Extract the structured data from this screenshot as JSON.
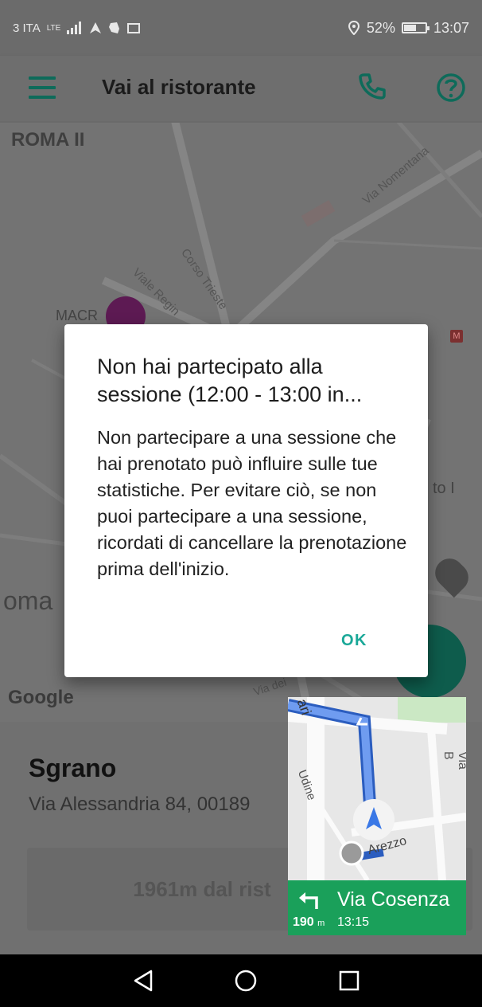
{
  "status_bar": {
    "carrier": "3 ITA",
    "network": "LTE",
    "battery_percent": "52%",
    "battery_level": 0.52,
    "time": "13:07"
  },
  "app_bar": {
    "title": "Vai al ristorante",
    "icons": [
      "menu-icon",
      "phone-icon",
      "help-icon"
    ]
  },
  "map": {
    "labels": {
      "roma_ii": "ROMA II",
      "via_nomentana": "Via Nomentana",
      "corso_trieste": "Corso Trieste",
      "viale_regina": "Viale Regin",
      "macro": "MACR",
      "roma": "oma",
      "via_dei": "Via dei",
      "sto": "to I"
    },
    "google_logo": "Google"
  },
  "restaurant": {
    "name": "Sgrano",
    "address": "Via Alessandria 84, 00189",
    "distance_button": "1961m dal rist"
  },
  "dialog": {
    "title": "Non hai partecipato alla sessione (12:00 - 13:00 in...",
    "body": "Non partecipare a una sessione che hai prenotato può influire sulle tue statistiche. Per evitare ciò, se non puoi partecipare a una sessione, ricordati di cancellare la prenotazione prima dell'inizio.",
    "ok_label": "OK"
  },
  "nav_widget": {
    "street": "Via Cosenza",
    "distance_value": "190",
    "distance_unit": "m",
    "eta": "13:15",
    "map_labels": {
      "ari": "ari",
      "udine": "Udine",
      "arezzo": "Arezzo",
      "via_b": "Via B"
    },
    "accent": "#1aa05a"
  },
  "colors": {
    "accent": "#1aa898",
    "dark_green": "#0e6b5a",
    "nav_green": "#1aa05a"
  }
}
